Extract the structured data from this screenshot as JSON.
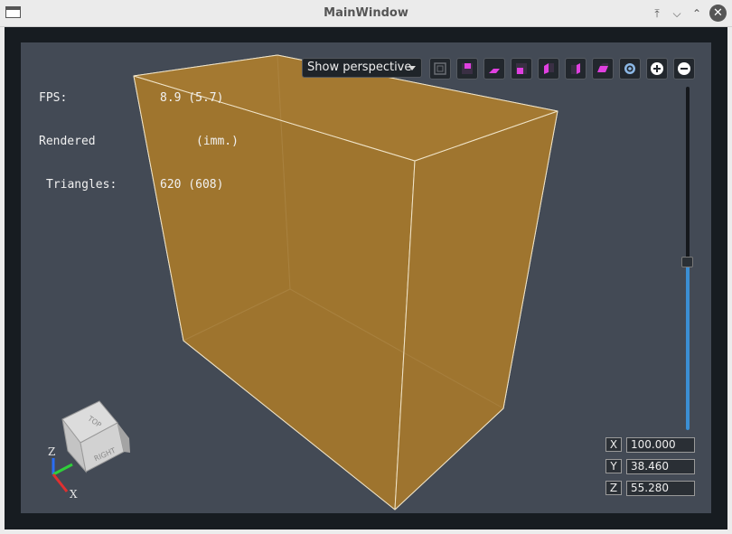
{
  "window": {
    "title": "MainWindow"
  },
  "stats": {
    "fps_label": "FPS:",
    "fps_value": "8.9 (5.7)",
    "rendered_label": "Rendered",
    "rendered_value": "(imm.)",
    "triangles_label": "Triangles:",
    "triangles_value": "620 (608)"
  },
  "toolbar": {
    "perspective_label": "Show perspective",
    "view_buttons": [
      "view-fit-icon",
      "view-top-icon",
      "view-bottom-icon",
      "view-front-icon",
      "view-back-icon",
      "view-left-icon",
      "view-right-icon",
      "settings-icon",
      "zoom-in-icon",
      "zoom-out-icon"
    ]
  },
  "zoom_slider": {
    "level": 0.49
  },
  "coords": {
    "x_label": "X",
    "x_value": "100.000",
    "y_label": "Y",
    "y_value": "38.460",
    "z_label": "Z",
    "z_value": "55.280"
  },
  "gizmo": {
    "top_label": "TOP",
    "right_label": "RIGHT",
    "axis_x": "X",
    "axis_z": "Z"
  },
  "colors": {
    "box_fill": "#a0762f",
    "viewport_bg": "#434a55",
    "accent": "#3b8fd4",
    "icon_magenta": "#e040e0"
  }
}
